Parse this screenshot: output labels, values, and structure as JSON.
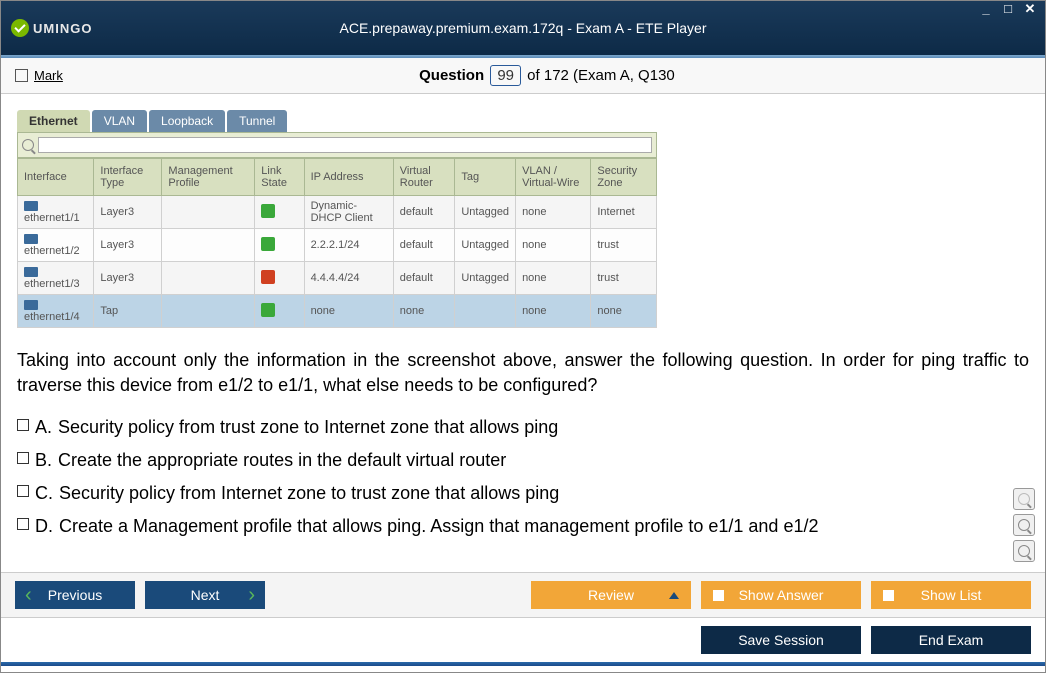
{
  "window": {
    "brand": "UMINGO",
    "title": "ACE.prepaway.premium.exam.172q - Exam A - ETE Player"
  },
  "questionBar": {
    "markLabel": "Mark",
    "label": "Question",
    "number": "99",
    "suffix": "of 172 (Exam A, Q130"
  },
  "innerTabs": [
    "Ethernet",
    "VLAN",
    "Loopback",
    "Tunnel"
  ],
  "tableHeaders": {
    "interface": "Interface",
    "type": "Interface Type",
    "profile": "Management Profile",
    "link": "Link State",
    "ip": "IP Address",
    "vr": "Virtual Router",
    "tag": "Tag",
    "vlan": "VLAN / Virtual-Wire",
    "zone": "Security Zone"
  },
  "rows": [
    {
      "if": "ethernet1/1",
      "type": "Layer3",
      "profile": "",
      "link": "green",
      "ip": "Dynamic-DHCP Client",
      "vr": "default",
      "tag": "Untagged",
      "vlan": "none",
      "zone": "Internet"
    },
    {
      "if": "ethernet1/2",
      "type": "Layer3",
      "profile": "",
      "link": "green",
      "ip": "2.2.2.1/24",
      "vr": "default",
      "tag": "Untagged",
      "vlan": "none",
      "zone": "trust"
    },
    {
      "if": "ethernet1/3",
      "type": "Layer3",
      "profile": "",
      "link": "red",
      "ip": "4.4.4.4/24",
      "vr": "default",
      "tag": "Untagged",
      "vlan": "none",
      "zone": "trust"
    },
    {
      "if": "ethernet1/4",
      "type": "Tap",
      "profile": "",
      "link": "green",
      "ip": "none",
      "vr": "none",
      "tag": "",
      "vlan": "none",
      "zone": "none"
    }
  ],
  "questionText": "Taking into account only the information in the screenshot above, answer the following question. In order for ping traffic to traverse this device from e1/2 to e1/1, what else needs to be configured?",
  "answers": [
    {
      "letter": "A.",
      "text": "Security policy from trust zone to Internet zone that allows ping"
    },
    {
      "letter": "B.",
      "text": "Create the appropriate routes in the default virtual router"
    },
    {
      "letter": "C.",
      "text": "Security policy from Internet zone to trust zone that allows ping"
    },
    {
      "letter": "D.",
      "text": "Create a Management profile that allows ping. Assign that management profile to e1/1 and e1/2"
    }
  ],
  "buttons": {
    "prev": "Previous",
    "next": "Next",
    "review": "Review",
    "showAnswer": "Show Answer",
    "showList": "Show List",
    "save": "Save Session",
    "end": "End Exam"
  }
}
